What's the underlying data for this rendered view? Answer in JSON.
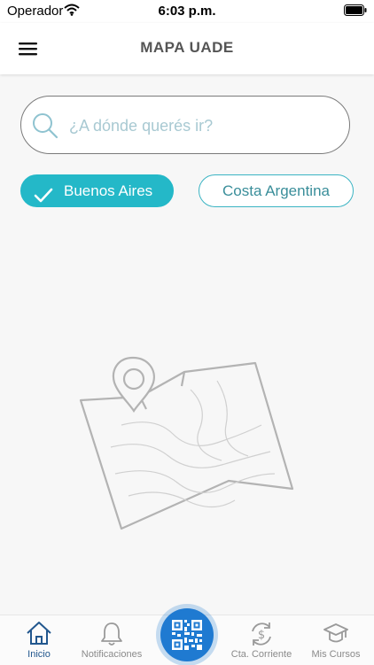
{
  "status_bar": {
    "carrier": "Operador",
    "time": "6:03 p.m."
  },
  "header": {
    "title": "MAPA UADE"
  },
  "search": {
    "placeholder": "¿A dónde querés ir?",
    "value": ""
  },
  "filters": [
    {
      "label": "Buenos Aires",
      "selected": true
    },
    {
      "label": "Costa Argentina",
      "selected": false
    }
  ],
  "tabs": [
    {
      "label": "Inicio",
      "icon": "home-icon",
      "selected": true
    },
    {
      "label": "Notificaciones",
      "icon": "bell-icon",
      "selected": false
    },
    {
      "label": "",
      "icon": "qr-code-icon",
      "selected": false
    },
    {
      "label": "Cta. Corriente",
      "icon": "dollar-cycle-icon",
      "selected": false
    },
    {
      "label": "Mis Cursos",
      "icon": "graduation-cap-icon",
      "selected": false
    }
  ],
  "colors": {
    "accent": "#24b8c8",
    "qr_button": "#1f7ad1",
    "tab_active": "#22578e",
    "placeholder": "#a8c9d2"
  }
}
